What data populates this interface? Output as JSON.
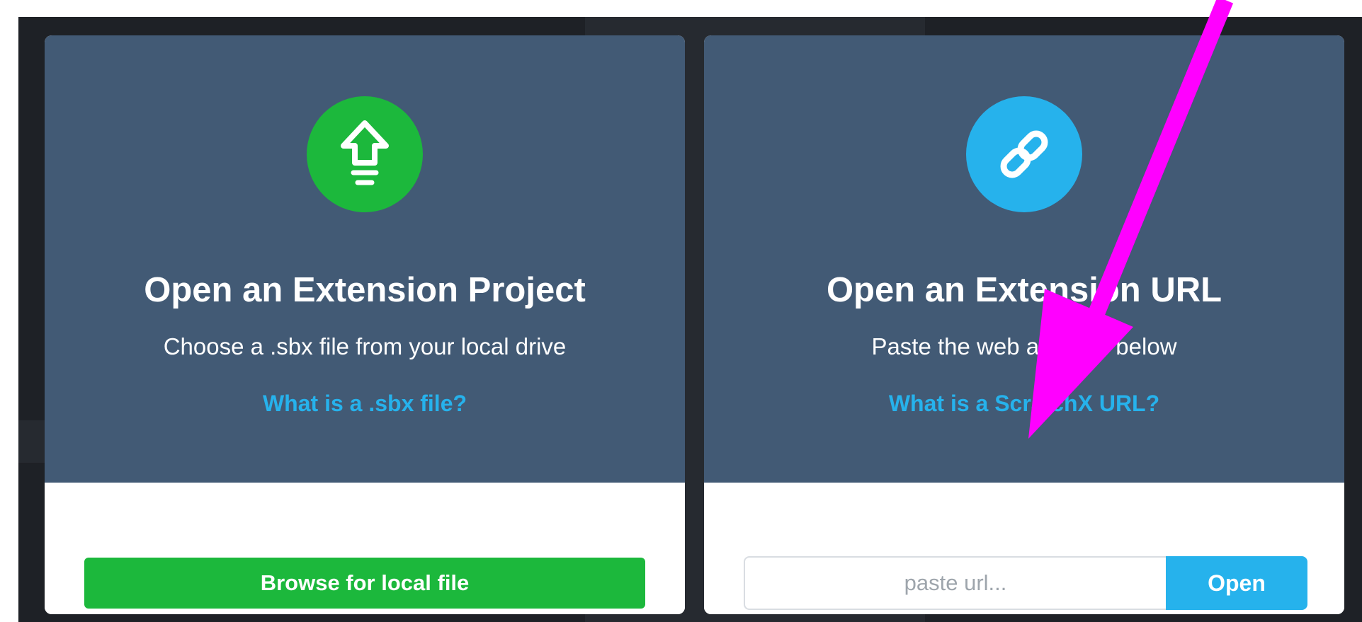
{
  "cards": {
    "project": {
      "title": "Open an Extension Project",
      "subtitle": "Choose a .sbx file from your local drive",
      "help_link": "What is a .sbx file?",
      "button_label": "Browse for local file",
      "icon": "upload-arrow-icon",
      "accent_color": "#1cb83c"
    },
    "url": {
      "title": "Open an Extension URL",
      "subtitle": "Paste the web address below",
      "help_link": "What is a ScratchX URL?",
      "input_placeholder": "paste url...",
      "button_label": "Open",
      "icon": "link-icon",
      "accent_color": "#26b2ec"
    }
  },
  "annotation": {
    "icon": "magenta-arrow",
    "color": "#ff00ff"
  }
}
